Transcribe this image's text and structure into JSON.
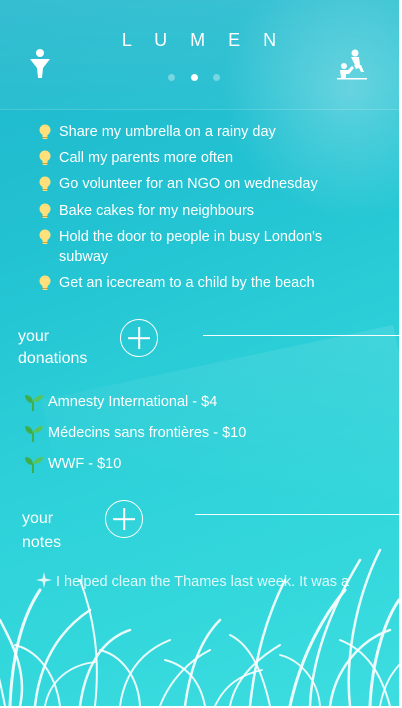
{
  "app": {
    "title": "L U M E N"
  },
  "ideas": [
    {
      "text": "Share my umbrella on a rainy day"
    },
    {
      "text": "Call my parents more often"
    },
    {
      "text": "Go volunteer for an NGO on wednesday"
    },
    {
      "text": "Bake cakes for my neighbours"
    },
    {
      "text": "Hold the door to people in busy London's subway"
    },
    {
      "text": "Get an icecream to a child by the beach"
    }
  ],
  "donations": {
    "label_line1": "your",
    "label_line2": "donations",
    "items": [
      {
        "text": "Amnesty International - $4"
      },
      {
        "text": "Médecins sans frontières - $10"
      },
      {
        "text": "WWF - $10"
      }
    ]
  },
  "notes": {
    "label_line1": "your",
    "label_line2": "notes",
    "preview": "I helped clean the Thames last week. It was a"
  },
  "pager": {
    "current": 2,
    "total": 3
  },
  "colors": {
    "background_top": "#1fb6cc",
    "background_bottom": "#3ddde0",
    "foreground": "#ffffff",
    "bulb": "#ffe07a",
    "sprout": "#3fae4a"
  },
  "icons": {
    "profile": "person-icon",
    "helping": "helping-hand-icon",
    "idea": "lightbulb-icon",
    "donation": "sprout-icon",
    "note": "sparkle-icon"
  }
}
